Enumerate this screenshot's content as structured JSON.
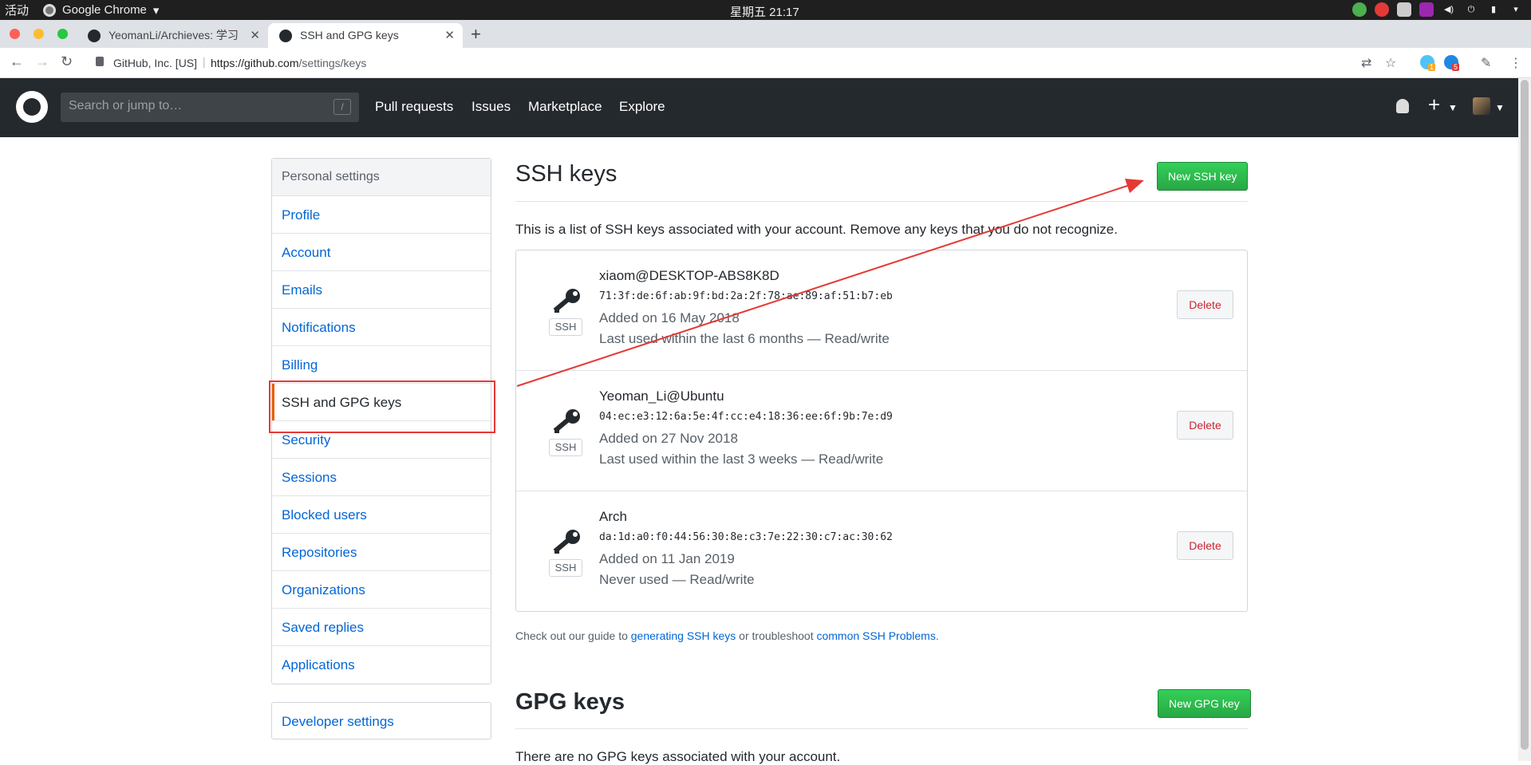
{
  "os": {
    "activities": "活动",
    "app_name": "Google Chrome",
    "clock": "星期五 21:17"
  },
  "browser": {
    "tabs": [
      {
        "title": "YeomanLi/Archieves: 学习"
      },
      {
        "title": "SSH and GPG keys"
      }
    ],
    "site_identity": "GitHub, Inc. [US]",
    "url_scheme_host": "https://github.com",
    "url_path": "/settings/keys",
    "extension_badges": [
      "1",
      "5"
    ]
  },
  "github_header": {
    "search_placeholder": "Search or jump to…",
    "search_shortcut": "/",
    "nav": [
      "Pull requests",
      "Issues",
      "Marketplace",
      "Explore"
    ]
  },
  "sidebar": {
    "heading": "Personal settings",
    "items": [
      {
        "label": "Profile"
      },
      {
        "label": "Account"
      },
      {
        "label": "Emails"
      },
      {
        "label": "Notifications"
      },
      {
        "label": "Billing"
      },
      {
        "label": "SSH and GPG keys"
      },
      {
        "label": "Security"
      },
      {
        "label": "Sessions"
      },
      {
        "label": "Blocked users"
      },
      {
        "label": "Repositories"
      },
      {
        "label": "Organizations"
      },
      {
        "label": "Saved replies"
      },
      {
        "label": "Applications"
      }
    ],
    "developer_settings": "Developer settings"
  },
  "ssh": {
    "title": "SSH keys",
    "new_button": "New SSH key",
    "description": "This is a list of SSH keys associated with your account. Remove any keys that you do not recognize.",
    "keys": [
      {
        "name": "xiaom@DESKTOP-ABS8K8D",
        "fingerprint": "71:3f:de:6f:ab:9f:bd:2a:2f:78:ae:89:af:51:b7:eb",
        "added": "Added on 16 May 2018",
        "used": "Last used within the last 6 months — Read/write",
        "badge": "SSH",
        "delete": "Delete"
      },
      {
        "name": "Yeoman_Li@Ubuntu",
        "fingerprint": "04:ec:e3:12:6a:5e:4f:cc:e4:18:36:ee:6f:9b:7e:d9",
        "added": "Added on 27 Nov 2018",
        "used": "Last used within the last 3 weeks — Read/write",
        "badge": "SSH",
        "delete": "Delete"
      },
      {
        "name": "Arch",
        "fingerprint": "da:1d:a0:f0:44:56:30:8e:c3:7e:22:30:c7:ac:30:62",
        "added": "Added on 11 Jan 2019",
        "used": "Never used — Read/write",
        "badge": "SSH",
        "delete": "Delete"
      }
    ],
    "guide_prefix": "Check out our guide to ",
    "guide_link1": "generating SSH keys",
    "guide_middle": " or troubleshoot ",
    "guide_link2": "common SSH Problems",
    "guide_suffix": "."
  },
  "gpg": {
    "title": "GPG keys",
    "new_button": "New GPG key",
    "description": "There are no GPG keys associated with your account."
  },
  "colors": {
    "annotation_red": "#e53935",
    "github_green": "#28a745",
    "link_blue": "#0366d6",
    "selected_accent": "#e36209"
  }
}
